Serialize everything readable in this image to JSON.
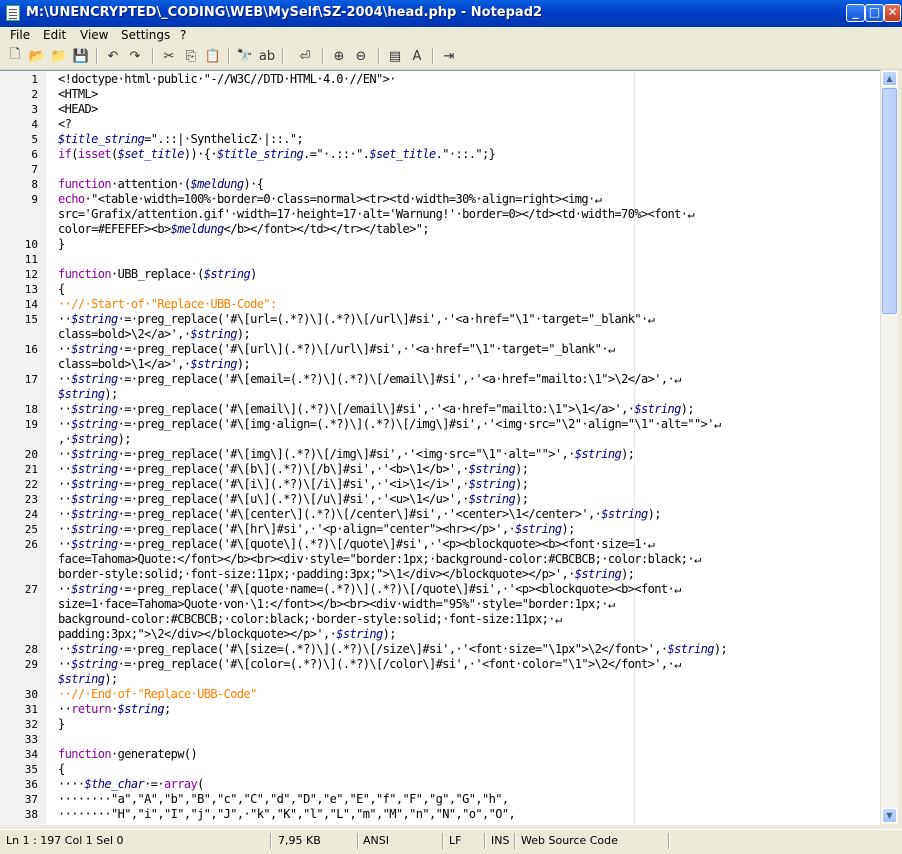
{
  "window": {
    "title": "M:\\UNENCRYPTED\\_CODING\\WEB\\MySelf\\SZ-2004\\head.php - Notepad2",
    "minimize": "_",
    "maximize": "□",
    "close": "✕"
  },
  "menu": [
    "File",
    "Edit",
    "View",
    "Settings",
    "?"
  ],
  "toolbar": [
    {
      "name": "new-file-icon",
      "glyph": "🗋"
    },
    {
      "name": "open-folder-icon",
      "glyph": "📂"
    },
    {
      "name": "browse-icon",
      "glyph": "📁"
    },
    {
      "name": "save-icon",
      "glyph": "💾"
    },
    {
      "name": "undo-icon",
      "glyph": "↶"
    },
    {
      "name": "redo-icon",
      "glyph": "↷"
    },
    {
      "name": "cut-icon",
      "glyph": "✂"
    },
    {
      "name": "copy-icon",
      "glyph": "⎘"
    },
    {
      "name": "paste-icon",
      "glyph": "📋"
    },
    {
      "name": "find-icon",
      "glyph": "🔭"
    },
    {
      "name": "replace-icon",
      "glyph": "ab"
    },
    {
      "name": "word-wrap-icon",
      "glyph": "⏎"
    },
    {
      "name": "zoom-in-icon",
      "glyph": "⊕"
    },
    {
      "name": "zoom-out-icon",
      "glyph": "⊖"
    },
    {
      "name": "scheme-icon",
      "glyph": "▤"
    },
    {
      "name": "font-icon",
      "glyph": "A"
    },
    {
      "name": "exit-icon",
      "glyph": "⇥"
    }
  ],
  "lines": [
    {
      "n": "1",
      "c": "<!doctype·html·public·\"-//W3C//DTD·HTML·4.0·//EN\">·"
    },
    {
      "n": "2",
      "c": "<HTML>"
    },
    {
      "n": "3",
      "c": "<HEAD>"
    },
    {
      "n": "4",
      "c": "<?"
    },
    {
      "n": "5",
      "c": "$title_string=\".::|·SynthelicZ·|::.\";"
    },
    {
      "n": "6",
      "c": "if(isset($set_title))·{·$title_string.=\"·.::·\".$set_title.\"·::.\";}"
    },
    {
      "n": "7",
      "c": ""
    },
    {
      "n": "8",
      "c": "function·attention·($meldung)·{"
    },
    {
      "n": "9",
      "c": "echo·\"<table·width=100%·border=0·class=normal><tr><td·width=30%·align=right><img·↵"
    },
    {
      "n": "",
      "c": "src='Grafix/attention.gif'·width=17·height=17·alt='Warnung!'·border=0></td><td·width=70%><font·↵"
    },
    {
      "n": "",
      "c": "color=#EFEFEF><b>$meldung</b></font></td></tr></table>\";"
    },
    {
      "n": "10",
      "c": "}"
    },
    {
      "n": "11",
      "c": ""
    },
    {
      "n": "12",
      "c": "function·UBB_replace·($string)"
    },
    {
      "n": "13",
      "c": "{"
    },
    {
      "n": "14",
      "c": "··//·Start·of·\"Replace·UBB-Code\":"
    },
    {
      "n": "15",
      "c": "··$string·=·preg_replace('#\\[url=(.*?)\\](.*?)\\[/url\\]#si',·'<a·href=\"\\1\"·target=\"_blank\"·↵"
    },
    {
      "n": "",
      "c": "class=bold>\\2</a>',·$string);"
    },
    {
      "n": "16",
      "c": "··$string·=·preg_replace('#\\[url\\](.*?)\\[/url\\]#si',·'<a·href=\"\\1\"·target=\"_blank\"·↵"
    },
    {
      "n": "",
      "c": "class=bold>\\1</a>',·$string);"
    },
    {
      "n": "17",
      "c": "··$string·=·preg_replace('#\\[email=(.*?)\\](.*?)\\[/email\\]#si',·'<a·href=\"mailto:\\1\">\\2</a>',·↵"
    },
    {
      "n": "",
      "c": "$string);"
    },
    {
      "n": "18",
      "c": "··$string·=·preg_replace('#\\[email\\](.*?)\\[/email\\]#si',·'<a·href=\"mailto:\\1\">\\1</a>',·$string);"
    },
    {
      "n": "19",
      "c": "··$string·=·preg_replace('#\\[img·align=(.*?)\\](.*?)\\[/img\\]#si',·'<img·src=\"\\2\"·align=\"\\1\"·alt=\"\">'↵"
    },
    {
      "n": "",
      "c": ",·$string);"
    },
    {
      "n": "20",
      "c": "··$string·=·preg_replace('#\\[img\\](.*?)\\[/img\\]#si',·'<img·src=\"\\1\"·alt=\"\">',·$string);"
    },
    {
      "n": "21",
      "c": "··$string·=·preg_replace('#\\[b\\](.*?)\\[/b\\]#si',·'<b>\\1</b>',·$string);"
    },
    {
      "n": "22",
      "c": "··$string·=·preg_replace('#\\[i\\](.*?)\\[/i\\]#si',·'<i>\\1</i>',·$string);"
    },
    {
      "n": "23",
      "c": "··$string·=·preg_replace('#\\[u\\](.*?)\\[/u\\]#si',·'<u>\\1</u>',·$string);"
    },
    {
      "n": "24",
      "c": "··$string·=·preg_replace('#\\[center\\](.*?)\\[/center\\]#si',·'<center>\\1</center>',·$string);"
    },
    {
      "n": "25",
      "c": "··$string·=·preg_replace('#\\[hr\\]#si',·'<p·align=\"center\"><hr></p>',·$string);"
    },
    {
      "n": "26",
      "c": "··$string·=·preg_replace('#\\[quote\\](.*?)\\[/quote\\]#si',·'<p><blockquote><b><font·size=1·↵"
    },
    {
      "n": "",
      "c": "face=Tahoma>Quote:</font></b><br><div·style=\"border:1px;·background-color:#CBCBCB;·color:black;·↵"
    },
    {
      "n": "",
      "c": "border-style:solid;·font-size:11px;·padding:3px;\">\\1</div></blockquote></p>',·$string);"
    },
    {
      "n": "27",
      "c": "··$string·=·preg_replace('#\\[quote·name=(.*?)\\](.*?)\\[/quote\\]#si',·'<p><blockquote><b><font·↵"
    },
    {
      "n": "",
      "c": "size=1·face=Tahoma>Quote·von·\\1:</font></b><br><div·width=\"95%\"·style=\"border:1px;·↵"
    },
    {
      "n": "",
      "c": "background-color:#CBCBCB;·color:black;·border-style:solid;·font-size:11px;·↵"
    },
    {
      "n": "",
      "c": "padding:3px;\">\\2</div></blockquote></p>',·$string);"
    },
    {
      "n": "28",
      "c": "··$string·=·preg_replace('#\\[size=(.*?)\\](.*?)\\[/size\\]#si',·'<font·size=\"\\1px\">\\2</font>',·$string);"
    },
    {
      "n": "29",
      "c": "··$string·=·preg_replace('#\\[color=(.*?)\\](.*?)\\[/color\\]#si',·'<font·color=\"\\1\">\\2</font>',·↵"
    },
    {
      "n": "",
      "c": "$string);"
    },
    {
      "n": "30",
      "c": "··//·End·of·\"Replace·UBB-Code\""
    },
    {
      "n": "31",
      "c": "··return·$string;"
    },
    {
      "n": "32",
      "c": "}"
    },
    {
      "n": "33",
      "c": ""
    },
    {
      "n": "34",
      "c": "function·generatepw()"
    },
    {
      "n": "35",
      "c": "{"
    },
    {
      "n": "36",
      "c": "····$the_char·=·array("
    },
    {
      "n": "37",
      "c": "········\"a\",\"A\",\"b\",\"B\",\"c\",\"C\",\"d\",\"D\",\"e\",\"E\",\"f\",\"F\",\"g\",\"G\",\"h\","
    },
    {
      "n": "38",
      "c": "········\"H\",\"i\",\"I\",\"j\",\"J\",·\"k\",\"K\",\"l\",\"L\",\"m\",\"M\",\"n\",\"N\",\"o\",\"O\","
    }
  ],
  "status": {
    "position": "Ln 1 : 197   Col 1   Sel 0",
    "size": "7,95 KB",
    "encoding": "ANSI",
    "eol": "LF",
    "ovr": "INS",
    "scheme": "Web Source Code"
  },
  "colors": {
    "keyword": "#8B00A0",
    "variable": "#000080",
    "comment": "#FF8000",
    "titlebar": "#0A5FE0"
  }
}
